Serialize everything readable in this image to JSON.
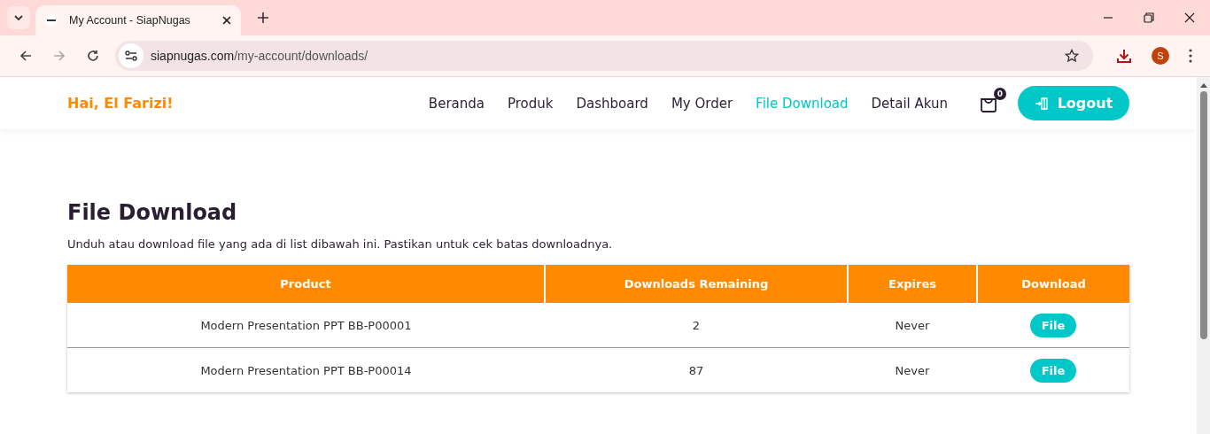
{
  "browser": {
    "tab_title": "My Account - SiapNugas",
    "url_host": "siapnugas.com",
    "url_path": "/my-account/downloads/",
    "profile_initial": "S"
  },
  "header": {
    "greeting": "Hai, El Farizi!",
    "nav": [
      {
        "label": "Beranda",
        "selected": false
      },
      {
        "label": "Produk",
        "selected": false
      },
      {
        "label": "Dashboard",
        "selected": false
      },
      {
        "label": "My Order",
        "selected": false
      },
      {
        "label": "File Download",
        "selected": true
      },
      {
        "label": "Detail Akun",
        "selected": false
      }
    ],
    "cart_count": "0",
    "logout": "Logout"
  },
  "page": {
    "title": "File Download",
    "description": "Unduh atau download file yang ada di list dibawah ini. Pastikan untuk cek batas downloadnya."
  },
  "table": {
    "columns": [
      "Product",
      "Downloads Remaining",
      "Expires",
      "Download"
    ],
    "rows": [
      {
        "product": "Modern Presentation PPT BB-P00001",
        "remaining": "2",
        "expires": "Never",
        "button": "File"
      },
      {
        "product": "Modern Presentation PPT BB-P00014",
        "remaining": "87",
        "expires": "Never",
        "button": "File"
      }
    ]
  }
}
